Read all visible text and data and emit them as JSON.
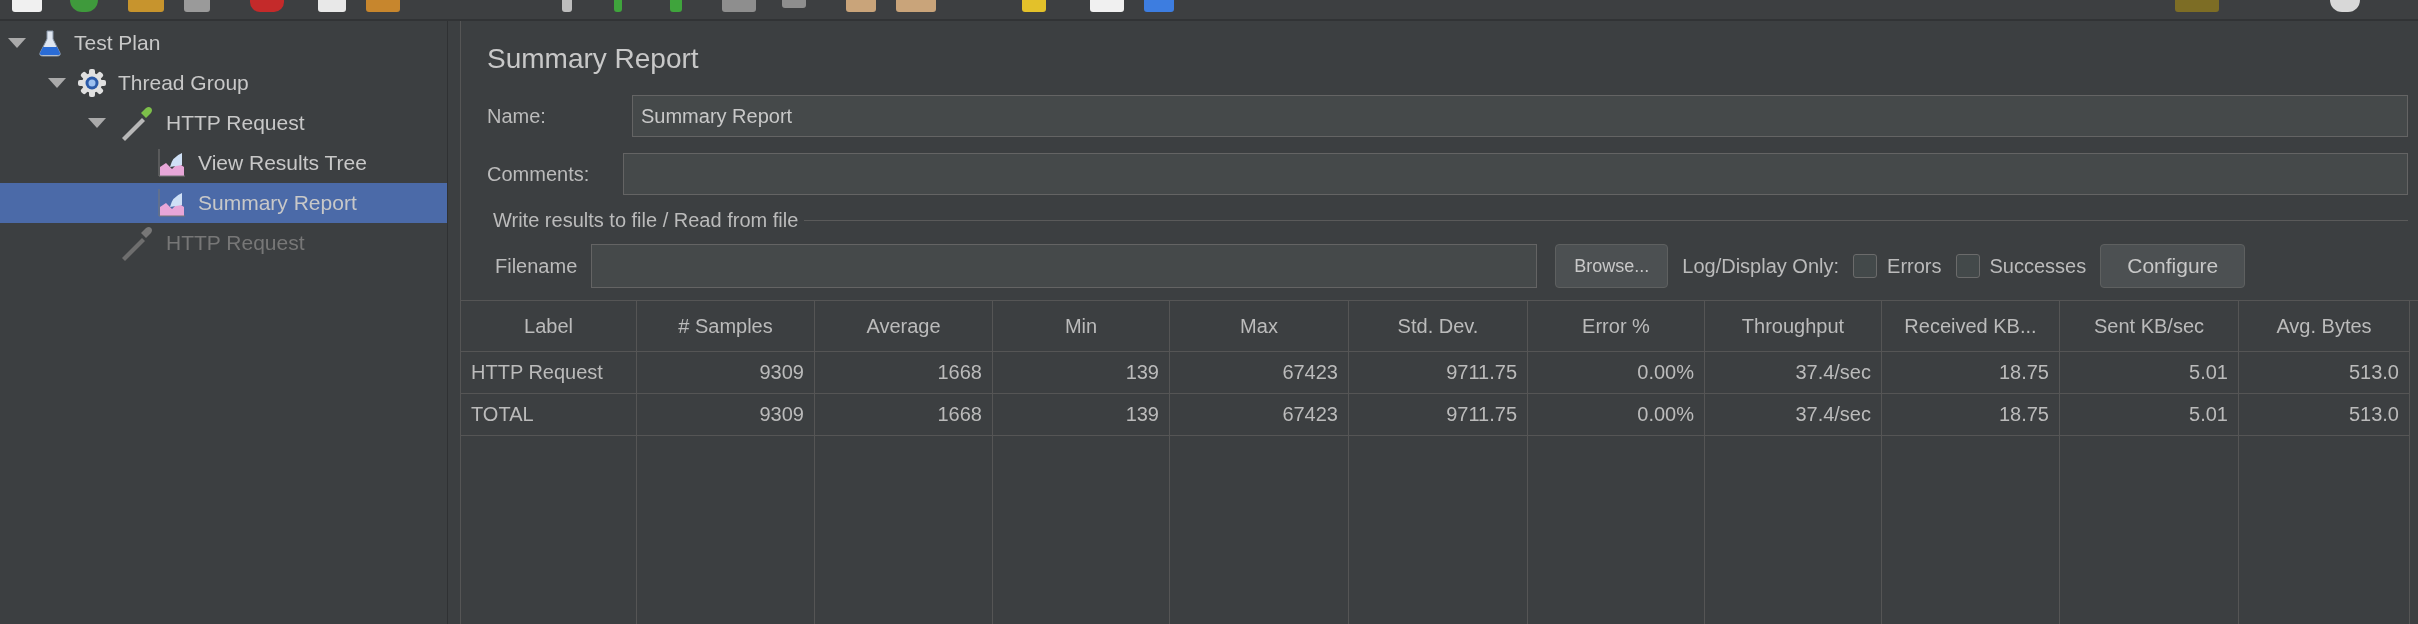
{
  "tree": [
    {
      "label": "Test Plan",
      "kind": "test-plan",
      "expanded": true,
      "selected": false,
      "disabled": false,
      "children": [
        {
          "label": "Thread Group",
          "kind": "thread-group",
          "expanded": true,
          "selected": false,
          "disabled": false,
          "children": [
            {
              "label": "HTTP Request",
              "kind": "sampler",
              "expanded": true,
              "selected": false,
              "disabled": false,
              "children": [
                {
                  "label": "View Results Tree",
                  "kind": "listener",
                  "selected": false,
                  "disabled": false
                },
                {
                  "label": "Summary Report",
                  "kind": "listener",
                  "selected": true,
                  "disabled": false
                }
              ]
            },
            {
              "label": "HTTP Request",
              "kind": "sampler",
              "selected": false,
              "disabled": true
            }
          ]
        }
      ]
    }
  ],
  "panel": {
    "title": "Summary Report",
    "name": {
      "label": "Name:",
      "value": "Summary Report"
    },
    "comments": {
      "label": "Comments:"
    },
    "file_group": {
      "title": "Write results to file / Read from file",
      "filename_label": "Filename",
      "browse_button": "Browse...",
      "log_label": "Log/Display Only:",
      "checkboxes": [
        {
          "label": "Errors",
          "checked": false
        },
        {
          "label": "Successes",
          "checked": false
        }
      ],
      "configure_button": "Configure"
    }
  },
  "table": {
    "columns": [
      "Label",
      "# Samples",
      "Average",
      "Min",
      "Max",
      "Std. Dev.",
      "Error %",
      "Throughput",
      "Received KB...",
      "Sent KB/sec",
      "Avg. Bytes"
    ],
    "rows": [
      [
        "HTTP Request",
        "9309",
        "1668",
        "139",
        "67423",
        "9711.75",
        "0.00%",
        "37.4/sec",
        "18.75",
        "5.01",
        "513.0"
      ],
      [
        "TOTAL",
        "9309",
        "1668",
        "139",
        "67423",
        "9711.75",
        "0.00%",
        "37.4/sec",
        "18.75",
        "5.01",
        "513.0"
      ]
    ]
  }
}
